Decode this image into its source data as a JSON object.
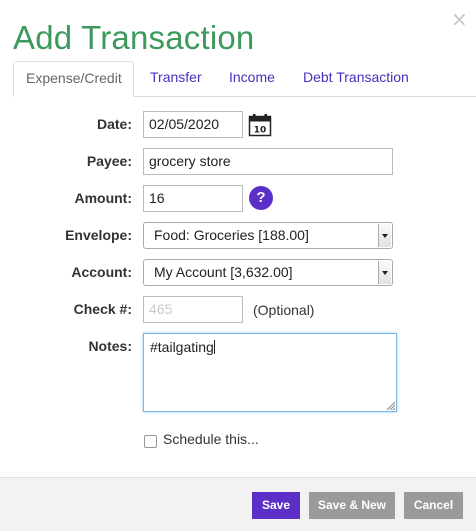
{
  "dialog": {
    "title": "Add Transaction",
    "close_glyph": "×"
  },
  "tabs": [
    {
      "label": "Expense/Credit",
      "active": true
    },
    {
      "label": "Transfer",
      "active": false
    },
    {
      "label": "Income",
      "active": false
    },
    {
      "label": "Debt Transaction",
      "active": false
    }
  ],
  "form": {
    "date": {
      "label": "Date:",
      "value": "02/05/2020",
      "calendar_icon_text": "10"
    },
    "payee": {
      "label": "Payee:",
      "value": "grocery store"
    },
    "amount": {
      "label": "Amount:",
      "value": "16",
      "help_glyph": "?"
    },
    "envelope": {
      "label": "Envelope:",
      "selected": "Food: Groceries [188.00]"
    },
    "account": {
      "label": "Account:",
      "selected": "My Account [3,632.00]"
    },
    "check": {
      "label": "Check #:",
      "placeholder": "465",
      "hint": "(Optional)"
    },
    "notes": {
      "label": "Notes:",
      "value": "#tailgating"
    },
    "schedule": {
      "label": "Schedule this...",
      "checked": false
    }
  },
  "footer": {
    "save_label": "Save",
    "save_new_label": "Save & New",
    "cancel_label": "Cancel"
  },
  "colors": {
    "title": "#3e9a5c",
    "tab_link": "#4a2fbd",
    "primary_button": "#5b2fc8",
    "secondary_button": "#9a9a9a"
  }
}
